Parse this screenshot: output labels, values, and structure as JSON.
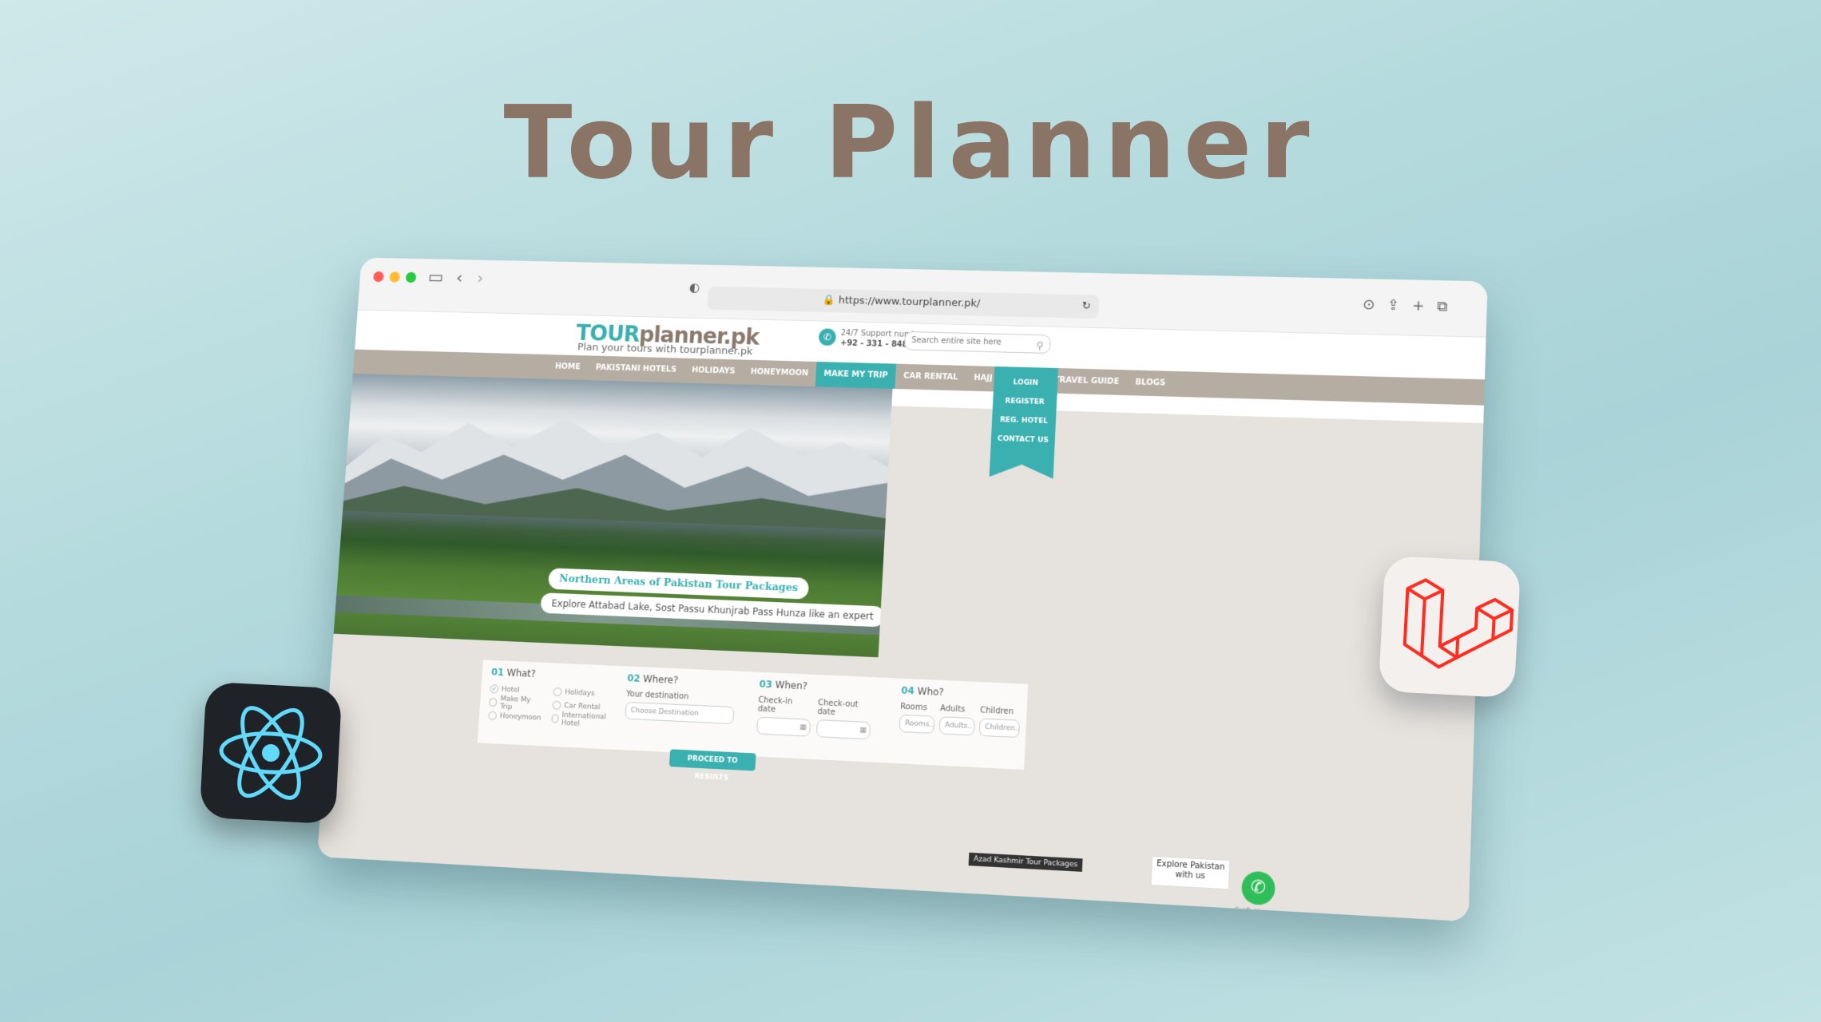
{
  "hero": {
    "title": "Tour Planner"
  },
  "browser": {
    "url": "https://www.tourplanner.pk/",
    "traffic_lights": [
      "#ff5f57",
      "#febc2e",
      "#28c840"
    ]
  },
  "site": {
    "logo_tour": "TOUR",
    "logo_rest": "planner.pk",
    "tagline": "Plan your tours with tourplanner.pk",
    "support_label": "24/7 Support number",
    "support_number": "+92 - 331 - 8483 - 626",
    "search_placeholder": "Search entire site here",
    "nav": [
      "HOME",
      "PAKISTANI HOTELS",
      "HOLIDAYS",
      "HONEYMOON",
      "MAKE MY TRIP",
      "CAR RENTAL",
      "HAJJ & UMRAH",
      "TRAVEL GUIDE",
      "BLOGS"
    ],
    "nav_active": "MAKE MY TRIP",
    "ribbon": [
      "LOGIN",
      "REGISTER",
      "REG. HOTEL",
      "CONTACT US"
    ],
    "slide_title": "Northern Areas of Pakistan Tour Packages",
    "slide_subtitle": "Explore Attabad Lake, Sost Passu Khunjrab Pass Hunza like an expert"
  },
  "search_form": {
    "what": {
      "num": "01",
      "label": "What?",
      "options": [
        "Hotel",
        "Make My Trip",
        "Honeymoon",
        "Holidays",
        "Car Rental",
        "International Hotel"
      ],
      "checked": "Hotel"
    },
    "where": {
      "num": "02",
      "label": "Where?",
      "field_label": "Your destination",
      "placeholder": "Choose Destination"
    },
    "when": {
      "num": "03",
      "label": "When?",
      "checkin": "Check-in date",
      "checkout": "Check-out date"
    },
    "who": {
      "num": "04",
      "label": "Who?",
      "rooms": "Rooms",
      "adults": "Adults",
      "children": "Children",
      "rooms_ph": "Rooms..",
      "adults_ph": "Adults..",
      "children_ph": "Children.."
    },
    "proceed": "PROCEED TO RESULTS"
  },
  "footer": {
    "badge": "Azad Kashmir Tour Packages",
    "chat": "Explore Pakistan with us",
    "getbutton": "GetButton"
  },
  "colors": {
    "accent": "#3bb0b0",
    "nav_bg": "#b5aca2",
    "title": "#8a7466",
    "react": "#61dafb",
    "laravel": "#ff2d20"
  }
}
